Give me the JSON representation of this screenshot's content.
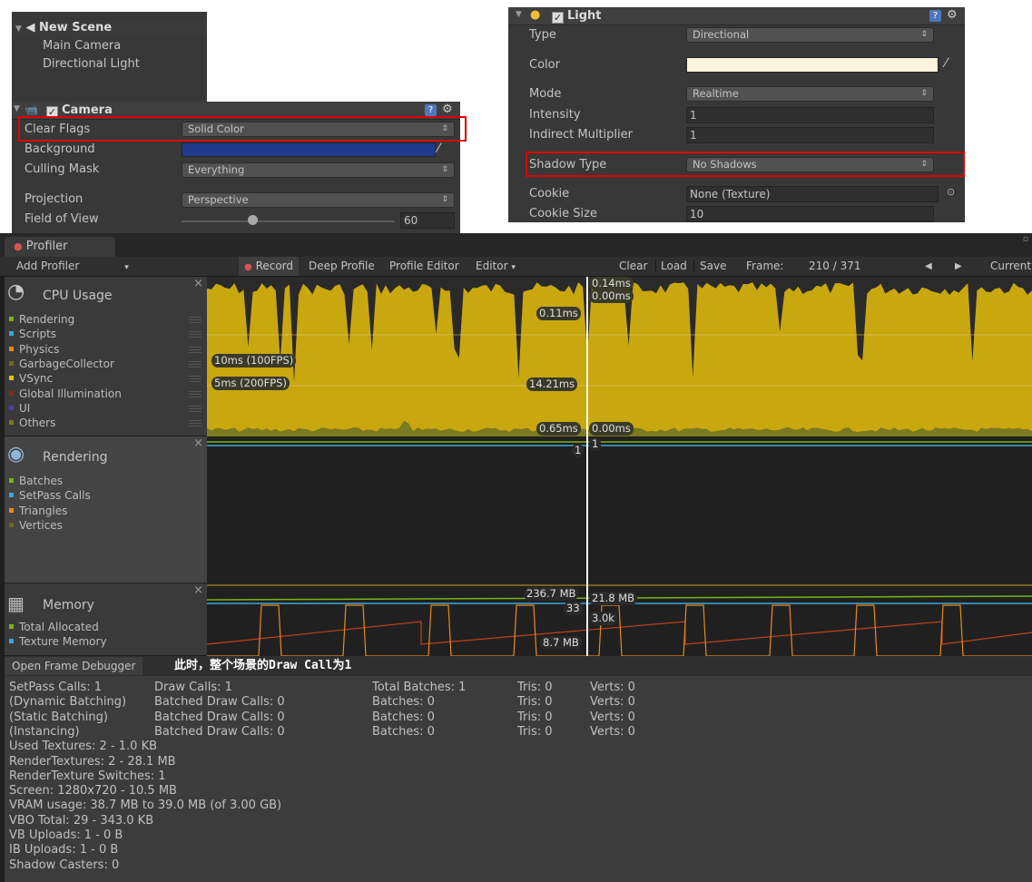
{
  "hierarchy": {
    "scene": "New Scene",
    "children": [
      "Main Camera",
      "Directional Light"
    ]
  },
  "camera": {
    "title": "Camera",
    "rows": {
      "clear_flags": {
        "label": "Clear Flags",
        "value": "Solid Color"
      },
      "background": {
        "label": "Background",
        "color": "#1f3a8a"
      },
      "culling_mask": {
        "label": "Culling Mask",
        "value": "Everything"
      },
      "projection": {
        "label": "Projection",
        "value": "Perspective"
      },
      "fov": {
        "label": "Field of View",
        "value": "60",
        "slider_fraction": 0.33
      }
    }
  },
  "light": {
    "title": "Light",
    "rows": {
      "type": {
        "label": "Type",
        "value": "Directional"
      },
      "color": {
        "label": "Color",
        "color": "#fff4dc"
      },
      "mode": {
        "label": "Mode",
        "value": "Realtime"
      },
      "intensity": {
        "label": "Intensity",
        "value": "1"
      },
      "indirect": {
        "label": "Indirect Multiplier",
        "value": "1"
      },
      "shadow_type": {
        "label": "Shadow Type",
        "value": "No Shadows"
      },
      "cookie": {
        "label": "Cookie",
        "value": "None (Texture)"
      },
      "cookie_size": {
        "label": "Cookie Size",
        "value": "10"
      }
    }
  },
  "profiler": {
    "tab": "Profiler",
    "toolbar": {
      "add_profiler": "Add Profiler",
      "record": "Record",
      "deep_profile": "Deep Profile",
      "profile_editor": "Profile Editor",
      "editor": "Editor",
      "clear": "Clear",
      "load": "Load",
      "save": "Save",
      "frame_label": "Frame:",
      "frame_value": "210 / 371",
      "current": "Current"
    },
    "cpu": {
      "title": "CPU Usage",
      "legend": [
        {
          "name": "Rendering",
          "color": "#7ab317"
        },
        {
          "name": "Scripts",
          "color": "#3aa6d9"
        },
        {
          "name": "Physics",
          "color": "#e88a1a"
        },
        {
          "name": "GarbageCollector",
          "color": "#6b6b1a"
        },
        {
          "name": "VSync",
          "color": "#e6c400"
        },
        {
          "name": "Global Illumination",
          "color": "#8b2a0e"
        },
        {
          "name": "UI",
          "color": "#5a3a99"
        },
        {
          "name": "Others",
          "color": "#7a7a20"
        }
      ],
      "labels": {
        "fps100": "10ms (100FPS)",
        "fps200": "5ms (200FPS)",
        "top_left": "0.11ms",
        "top_right1": "0.14ms",
        "top_right2": "0.00ms",
        "mid": "14.21ms",
        "bottom_left": "0.65ms",
        "bottom_right": "0.00ms"
      }
    },
    "rendering": {
      "title": "Rendering",
      "legend": [
        {
          "name": "Batches",
          "color": "#7ab317"
        },
        {
          "name": "SetPass Calls",
          "color": "#3aa6d9"
        },
        {
          "name": "Triangles",
          "color": "#e88a1a"
        },
        {
          "name": "Vertices",
          "color": "#6b6b1a"
        }
      ],
      "labels": {
        "left": "1",
        "right": "1"
      }
    },
    "memory": {
      "title": "Memory",
      "legend": [
        {
          "name": "Total Allocated",
          "color": "#7ab317"
        },
        {
          "name": "Texture Memory",
          "color": "#3aa6d9"
        }
      ],
      "labels": {
        "total": "236.7 MB",
        "right": "21.8 MB",
        "count": "33",
        "k": "3.0k",
        "low": "8.7 MB"
      }
    },
    "open_frame_debugger": "Open Frame Debugger",
    "annotation": "此时，整个场景的Draw Call为1",
    "details": {
      "col1": [
        "SetPass Calls: 1",
        "(Dynamic Batching)",
        "(Static Batching)",
        "(Instancing)",
        "Used Textures: 2 - 1.0 KB",
        "RenderTextures: 2 - 28.1 MB",
        "RenderTexture Switches: 1",
        "Screen: 1280x720 - 10.5 MB",
        "VRAM usage: 38.7 MB to 39.0 MB (of 3.00 GB)",
        "VBO Total: 29 - 343.0 KB",
        "VB Uploads: 1 - 0 B",
        "IB Uploads: 1 - 0 B",
        "Shadow Casters: 0"
      ],
      "col2": [
        "Draw Calls: 1",
        "Batched Draw Calls: 0",
        "Batched Draw Calls: 0",
        "Batched Draw Calls: 0"
      ],
      "col3": [
        "Total Batches: 1",
        "Batches: 0",
        "Batches: 0",
        "Batches: 0"
      ],
      "col4": [
        "Tris: 0",
        "Tris: 0",
        "Tris: 0",
        "Tris: 0"
      ],
      "col5": [
        "Verts: 0",
        "Verts: 0",
        "Verts: 0",
        "Verts: 0"
      ]
    }
  }
}
